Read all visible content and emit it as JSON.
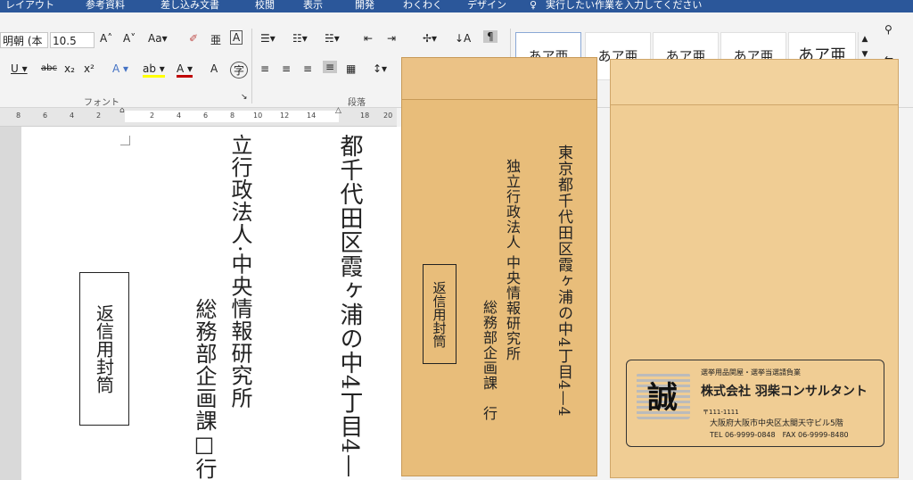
{
  "tabs": [
    "レイアウト",
    "参考資料",
    "差し込み文書",
    "校閲",
    "表示",
    "開発",
    "わくわく",
    "デザイン"
  ],
  "tell_me": "実行したい作業を入力してください",
  "font": {
    "name": "明朝 (本",
    "size": "10.5"
  },
  "groups": {
    "font": "フォント",
    "paragraph": "段落"
  },
  "styles": [
    "あア亜",
    "あア亜",
    "あア亜",
    "あア亜",
    "あア亜"
  ],
  "ruler_ticks": [
    "8",
    "6",
    "4",
    "2",
    "2",
    "4",
    "6",
    "8",
    "10",
    "12",
    "14",
    "18",
    "20"
  ],
  "doc": {
    "col_address": "都千代田区霞ヶ浦の中4丁目4—",
    "col_org": "立行政法人·中央情報研究所",
    "col_dept": "総務部企画課□行",
    "reply_box": "返信用封筒"
  },
  "envelope_a": {
    "address": "東京都千代田区霞ヶ浦の中4丁目4—4",
    "org": "独立行政法人 中央情報研究所",
    "dept": "総務部企画課　行",
    "reply_box": "返信用封筒"
  },
  "envelope_b": {
    "logo_char": "誠",
    "tagline": "選挙用品関屋・選挙当選請負業",
    "company": "株式会社 羽柴コンサルタント",
    "postal": "〒111-1111",
    "address": "大阪府大阪市中央区太閤天守ビル5階",
    "tel_fax": "TEL 06-9999-0848　FAX 06-9999-8480"
  },
  "colors": {
    "title_bar": "#2b579a",
    "envelope_kraft": "#e8bd7a",
    "envelope_light": "#f0cd94"
  }
}
